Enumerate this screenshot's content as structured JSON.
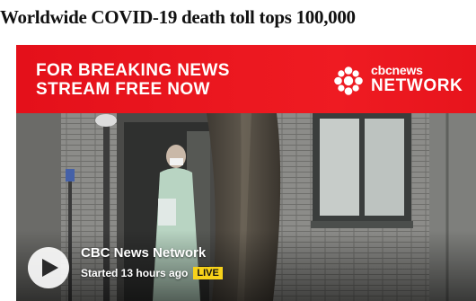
{
  "article": {
    "headline": "Worldwide COVID-19 death toll tops 100,000"
  },
  "player": {
    "promo_line1": "FOR BREAKING NEWS",
    "promo_line2": "STREAM FREE NOW",
    "brand_top": "cbcnews",
    "brand_bottom": "NETWORK",
    "channel_name": "CBC News Network",
    "started": "Started 13 hours ago",
    "live_badge": "LIVE",
    "play_icon": "play-icon",
    "logo_icon": "cbc-gem-icon",
    "colors": {
      "banner_red": "#ec1a21",
      "live_yellow": "#f7d21a"
    }
  }
}
